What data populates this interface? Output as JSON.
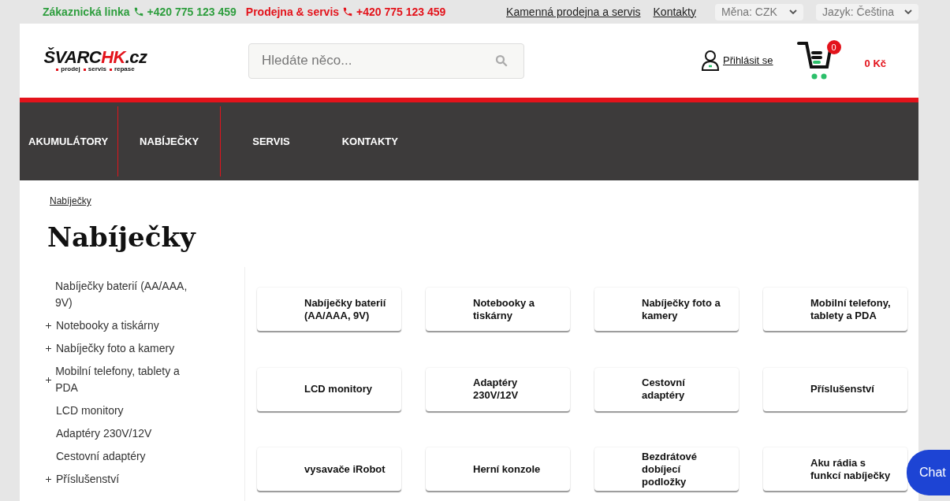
{
  "topbar": {
    "customer_line": {
      "label": "Zákaznická linka",
      "phone": "+420 775 123 459"
    },
    "shop_line": {
      "label": "Prodejna & servis",
      "phone": "+420 775 123 459"
    },
    "links": [
      "Kamenná prodejna a servis",
      "Kontakty"
    ],
    "currency": "Měna: CZK",
    "language": "Jazyk: Čeština"
  },
  "header": {
    "logo": {
      "main": "ŠVARC",
      "accent": "HK",
      "suffix": ".cz",
      "tagline": [
        "prodej",
        "servis",
        "repase"
      ]
    },
    "search": {
      "placeholder": "Hledáte něco..."
    },
    "login": "Přihlásit se",
    "cart": {
      "count": "0",
      "total": "0 Kč"
    }
  },
  "nav": [
    "AKUMULÁTORY",
    "NABÍJEČKY",
    "SERVIS",
    "KONTAKTY"
  ],
  "breadcrumb": [
    "Nabíječky"
  ],
  "title": "Nabíječky",
  "sidebar": [
    {
      "label": "Nabíječky baterií (AA/AAA, 9V)",
      "expandable": false
    },
    {
      "label": "Notebooky a tiskárny",
      "expandable": true
    },
    {
      "label": "Nabíječky foto a kamery",
      "expandable": true
    },
    {
      "label": "Mobilní telefony, tablety a PDA",
      "expandable": true
    },
    {
      "label": "LCD monitory",
      "expandable": false
    },
    {
      "label": "Adaptéry 230V/12V",
      "expandable": false
    },
    {
      "label": "Cestovní adaptéry",
      "expandable": false
    },
    {
      "label": "Příslušenství",
      "expandable": true
    }
  ],
  "categories": [
    "Nabíječky baterií (AA/AAA, 9V)",
    "Notebooky a tiskárny",
    "Nabíječky foto a kamery",
    "Mobilní telefony, tablety a PDA",
    "LCD monitory",
    "Adaptéry 230V/12V",
    "Cestovní adaptéry",
    "Příslušenství",
    "vysavače iRobot",
    "Herní konzole",
    "Bezdrátové dobíjecí podložky",
    "Aku rádia s funkcí nabíječky"
  ],
  "chat": "Chat"
}
